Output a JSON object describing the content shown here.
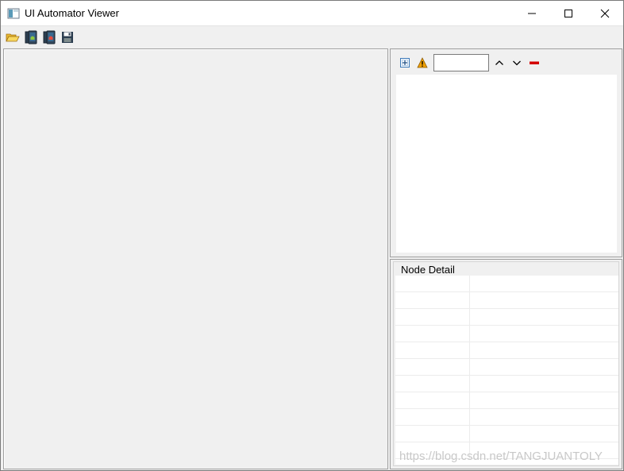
{
  "window": {
    "title": "UI Automator Viewer",
    "icon": "app-icon",
    "controls": [
      "minimize-icon",
      "maximize-icon",
      "close-icon"
    ]
  },
  "toolbar": {
    "buttons": [
      {
        "name": "open-icon"
      },
      {
        "name": "device-screenshot-icon"
      },
      {
        "name": "device-screenshot-compressed-icon"
      },
      {
        "name": "save-icon"
      }
    ]
  },
  "tree": {
    "tools": [
      "expand-all-icon",
      "warning-icon",
      "search-input",
      "previous-icon",
      "next-icon",
      "clear-icon"
    ],
    "search": {
      "value": "",
      "placeholder": ""
    }
  },
  "detail": {
    "group_label": "Node Detail",
    "rows": 11
  },
  "watermark": {
    "text": "https://blog.csdn.net/TANGJUANTOLY"
  },
  "colors": {
    "title_bg": "#ffffff",
    "panel_bg": "#f0f0f0",
    "border": "#a0a0a0",
    "clear_red": "#d40000",
    "warning": "#f0a000"
  }
}
